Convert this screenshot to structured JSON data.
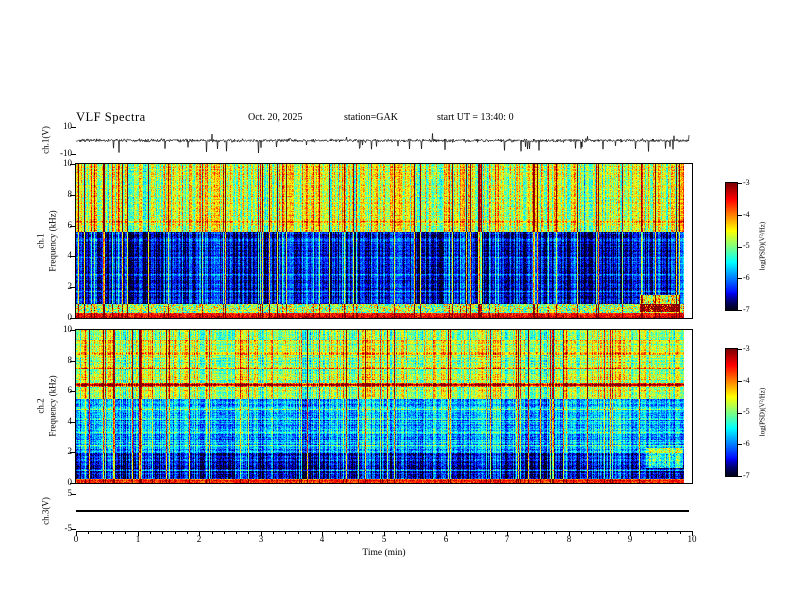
{
  "header": {
    "title": "VLF Spectra",
    "date": "Oct. 20, 2025",
    "station": "station=GAK",
    "start_ut": "start UT =  13:40: 0"
  },
  "time_axis": {
    "label": "Time (min)",
    "ticks": [
      "0",
      "1",
      "2",
      "3",
      "4",
      "5",
      "6",
      "7",
      "8",
      "9",
      "10"
    ]
  },
  "wave1": {
    "ylabel": "ch.1(V)",
    "yticks": [
      "10",
      "-10"
    ]
  },
  "spec1": {
    "ylabel_channel": "ch.1",
    "ylabel_axis": "Frequency (kHz)",
    "yticks": [
      "10",
      "8",
      "6",
      "4",
      "2",
      "0"
    ]
  },
  "spec2": {
    "ylabel_channel": "ch.2",
    "ylabel_axis": "Frequency (kHz)",
    "yticks": [
      "10",
      "8",
      "6",
      "4",
      "2",
      "0"
    ]
  },
  "wave3": {
    "ylabel": "ch.3(V)",
    "yticks": [
      "5",
      "-5"
    ]
  },
  "colorbar": {
    "label": "log(PSD)(V²/Hz)",
    "ticks": [
      "-3",
      "-4",
      "-5",
      "-6",
      "-7"
    ]
  },
  "chart_data": [
    {
      "id": "ch1_waveform",
      "type": "line",
      "panel": "ch.1(V)",
      "xlim": [
        0,
        10
      ],
      "xlabel": "Time (min)",
      "ylim": [
        -10,
        10
      ],
      "yticks": [
        10,
        -10
      ],
      "description": "Broadband VLF time series: continuous noise band of roughly ±2 V about zero with frequent impulsive sferic spikes, mostly downward reaching about -9 V, a few upward to about +4 V, spanning 0 to ~9.9 min.",
      "gen": {
        "seed": 7,
        "noise_v": 1.15,
        "spike_rate": 0.015,
        "spike_v_min": 3,
        "spike_v_max": 9,
        "up_spike_rate": 0.005
      }
    },
    {
      "id": "ch1_spectrogram",
      "type": "heatmap",
      "panel": "ch.1 Frequency (kHz)",
      "xlim": [
        0,
        10
      ],
      "ylim": [
        0,
        10
      ],
      "zlabel": "log(PSD)(V²/Hz)",
      "zlim": [
        -7,
        -3
      ],
      "colormap": "jet",
      "legend_position": "right-colorbar",
      "description": "Dense vertical sferic striping. 6-10 kHz: green/yellow/red high-power band. 1-5.6 kHz: dark navy background crossed by cyan/green vertical impulses and faint horizontal lines. 0.35-0.95 kHz: bright multicolor speckle strip. 0-0.35 kHz: saturated red/orange band. Orange patch near 9.2-9.8 min at 0.5-1.5 kHz.",
      "gen": {
        "seed": 41,
        "x_data_end": 9.85,
        "impulse_rate": 0.1,
        "impulse_boost": 1.55,
        "row_noise": 0.22,
        "bands": [
          {
            "f0": 0,
            "f1": 0.35,
            "level": -3.45,
            "noise": 0.7,
            "stripe": 0.25
          },
          {
            "f0": 0.35,
            "f1": 0.95,
            "level": -4.85,
            "noise": 1.6,
            "stripe": 0.5
          },
          {
            "f0": 0.95,
            "f1": 5.6,
            "level": -6.5,
            "noise": 0.55,
            "stripe": 0.85
          },
          {
            "f0": 5.6,
            "f1": 10.01,
            "level": -4.7,
            "noise": 0.75,
            "stripe": 1.05
          }
        ],
        "h_lines": [
          {
            "f": 1.75,
            "boost": 0.45,
            "hw": 0.07
          },
          {
            "f": 2.85,
            "boost": 0.4,
            "hw": 0.07
          },
          {
            "f": 3.95,
            "boost": 0.35,
            "hw": 0.07
          },
          {
            "f": 5.1,
            "boost": 0.5,
            "hw": 0.08
          },
          {
            "f": 6.3,
            "boost": 0.5,
            "hw": 0.08
          }
        ],
        "blob": {
          "x0": 9.15,
          "x1": 9.8,
          "f0": 0.45,
          "f1": 1.5,
          "boost": 2.4
        }
      }
    },
    {
      "id": "ch2_spectrogram",
      "type": "heatmap",
      "panel": "ch.2 Frequency (kHz)",
      "xlim": [
        0,
        10
      ],
      "ylim": [
        0,
        10
      ],
      "zlabel": "log(PSD)(V²/Hz)",
      "zlim": [
        -7,
        -3
      ],
      "colormap": "jet",
      "legend_position": "right-colorbar",
      "description": "Similar sferic striping but with stronger horizontal interference lines: intense orange/red line near 6.45 kHz, weaker yellow/green lines near 7.6, 8.5, 4.8, 3.4, 2.4, 1.5 kHz. 2-5.5 kHz band is brighter blue/cyan speckle; 0.3-2 kHz dark navy; 0-0.3 kHz red/orange band; cyan-green patch near 9.3-9.85 min at 1-2.3 kHz.",
      "gen": {
        "seed": 97,
        "x_data_end": 9.85,
        "impulse_rate": 0.09,
        "impulse_boost": 1.5,
        "row_noise": 0.3,
        "bands": [
          {
            "f0": 0,
            "f1": 0.3,
            "level": -3.6,
            "noise": 0.7,
            "stripe": 0.25
          },
          {
            "f0": 0.3,
            "f1": 2.0,
            "level": -6.5,
            "noise": 0.6,
            "stripe": 0.8
          },
          {
            "f0": 2.0,
            "f1": 5.5,
            "level": -5.8,
            "noise": 0.7,
            "stripe": 0.7
          },
          {
            "f0": 5.5,
            "f1": 10.01,
            "level": -4.8,
            "noise": 0.7,
            "stripe": 0.9
          }
        ],
        "h_lines": [
          {
            "f": 0.85,
            "boost": 0.6,
            "hw": 0.06
          },
          {
            "f": 1.55,
            "boost": 0.5,
            "hw": 0.06
          },
          {
            "f": 2.45,
            "boost": 0.55,
            "hw": 0.07
          },
          {
            "f": 3.35,
            "boost": 0.6,
            "hw": 0.07
          },
          {
            "f": 4.2,
            "boost": 0.55,
            "hw": 0.07
          },
          {
            "f": 4.85,
            "boost": 0.6,
            "hw": 0.08
          },
          {
            "f": 6.45,
            "boost": 2.1,
            "hw": 0.14
          },
          {
            "f": 7.55,
            "boost": 0.8,
            "hw": 0.09
          },
          {
            "f": 8.5,
            "boost": 0.6,
            "hw": 0.08
          },
          {
            "f": 9.3,
            "boost": 0.4,
            "hw": 0.07
          }
        ],
        "blob": {
          "x0": 9.25,
          "x1": 9.85,
          "f0": 1.0,
          "f1": 2.3,
          "boost": 1.5
        }
      }
    },
    {
      "id": "ch3_waveform",
      "type": "line",
      "panel": "ch.3(V)",
      "xlim": [
        0,
        10
      ],
      "ylim": [
        -5,
        5
      ],
      "yticks": [
        5,
        -5
      ],
      "constant_value": 0,
      "description": "Flat trace at 0 V for the entire 0-9.9 min interval."
    }
  ]
}
